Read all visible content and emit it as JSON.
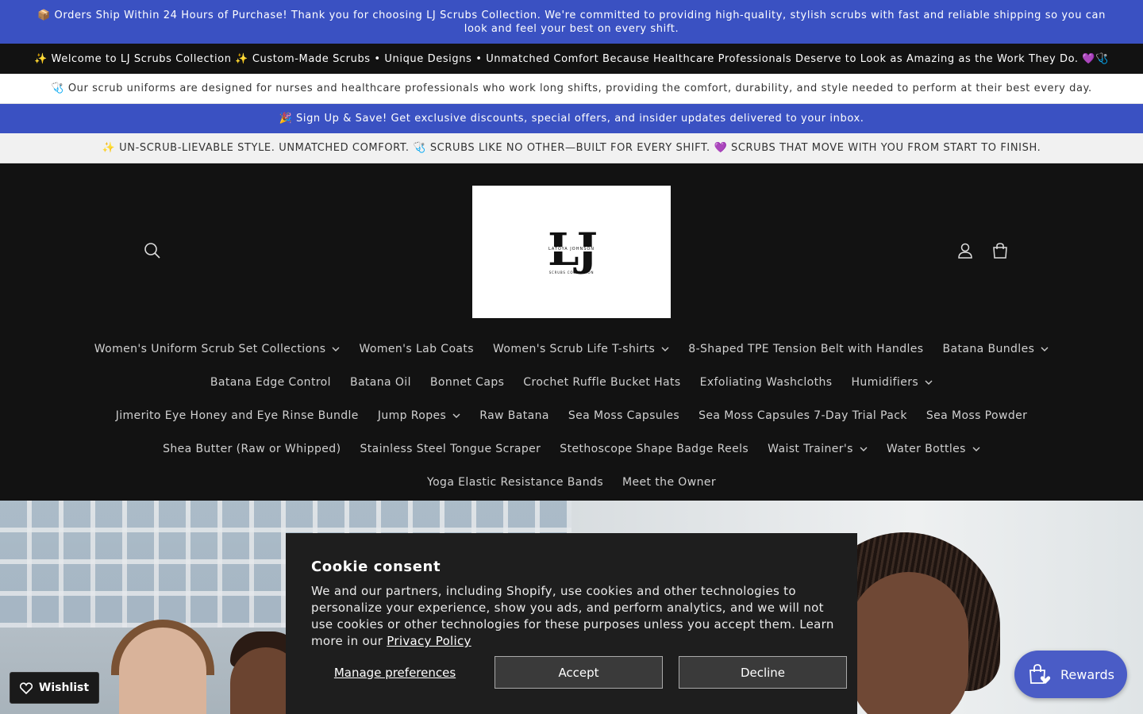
{
  "announcements": {
    "bar1": "📦 Orders Ship Within 24 Hours of Purchase! Thank you for choosing LJ Scrubs Collection. We're committed to providing high-quality, stylish scrubs with fast and reliable shipping so you can look and feel your best on every shift.",
    "bar2": "✨ Welcome to LJ Scrubs Collection ✨ Custom-Made Scrubs • Unique Designs • Unmatched Comfort Because Healthcare Professionals Deserve to Look as Amazing as the Work They Do. 💜🩺",
    "bar3": "🩺 Our scrub uniforms are designed for nurses and healthcare professionals who work long shifts, providing the comfort, durability, and style needed to perform at their best every day.",
    "bar4": "🎉 Sign Up & Save! Get exclusive discounts, special offers, and insider updates delivered to your inbox.",
    "bar5": "✨ UN-SCRUB-LIEVABLE STYLE. UNMATCHED COMFORT. 🩺 SCRUBS LIKE NO OTHER—BUILT FOR EVERY SHIFT. 💜 SCRUBS THAT MOVE WITH YOU FROM START TO FINISH."
  },
  "header": {
    "logo_text": "LJ",
    "logo_sub": "LATOYA JOHNSON",
    "logo_sub2": "SCRUBS COLLECTION"
  },
  "nav": {
    "rows": [
      [
        {
          "label": "Women's Uniform Scrub Set Collections",
          "dropdown": true
        },
        {
          "label": "Women's Lab Coats",
          "dropdown": false
        },
        {
          "label": "Women's Scrub Life T-shirts",
          "dropdown": true
        },
        {
          "label": "8-Shaped TPE Tension Belt with Handles",
          "dropdown": false
        },
        {
          "label": "Batana Bundles",
          "dropdown": true
        }
      ],
      [
        {
          "label": "Batana Edge Control",
          "dropdown": false
        },
        {
          "label": "Batana Oil",
          "dropdown": false
        },
        {
          "label": "Bonnet Caps",
          "dropdown": false
        },
        {
          "label": "Crochet Ruffle Bucket Hats",
          "dropdown": false
        },
        {
          "label": "Exfoliating Washcloths",
          "dropdown": false
        },
        {
          "label": "Humidifiers",
          "dropdown": true
        }
      ],
      [
        {
          "label": "Jimerito Eye Honey and Eye Rinse Bundle",
          "dropdown": false
        },
        {
          "label": "Jump Ropes",
          "dropdown": true
        },
        {
          "label": "Raw Batana",
          "dropdown": false
        },
        {
          "label": "Sea Moss Capsules",
          "dropdown": false
        },
        {
          "label": "Sea Moss Capsules 7-Day Trial Pack",
          "dropdown": false
        },
        {
          "label": "Sea Moss Powder",
          "dropdown": false
        }
      ],
      [
        {
          "label": "Shea Butter (Raw or Whipped)",
          "dropdown": false
        },
        {
          "label": "Stainless Steel Tongue Scraper",
          "dropdown": false
        },
        {
          "label": "Stethoscope Shape Badge Reels",
          "dropdown": false
        },
        {
          "label": "Waist Trainer's",
          "dropdown": true
        },
        {
          "label": "Water Bottles",
          "dropdown": true
        }
      ],
      [
        {
          "label": "Yoga Elastic Resistance Bands",
          "dropdown": false
        },
        {
          "label": "Meet the Owner",
          "dropdown": false
        }
      ]
    ]
  },
  "cookie": {
    "title": "Cookie consent",
    "body": "We and our partners, including Shopify, use cookies and other technologies to personalize your experience, show you ads, and perform analytics, and we will not use cookies or other technologies for these purposes unless you accept them. Learn more in our ",
    "link": "Privacy Policy",
    "manage": "Manage preferences",
    "accept": "Accept",
    "decline": "Decline"
  },
  "wishlist": {
    "label": "Wishlist"
  },
  "rewards": {
    "label": "Rewards"
  },
  "colors": {
    "brand_blue": "#3a51c2",
    "header_bg": "#121212",
    "rewards_bg": "#4a5cc6"
  }
}
